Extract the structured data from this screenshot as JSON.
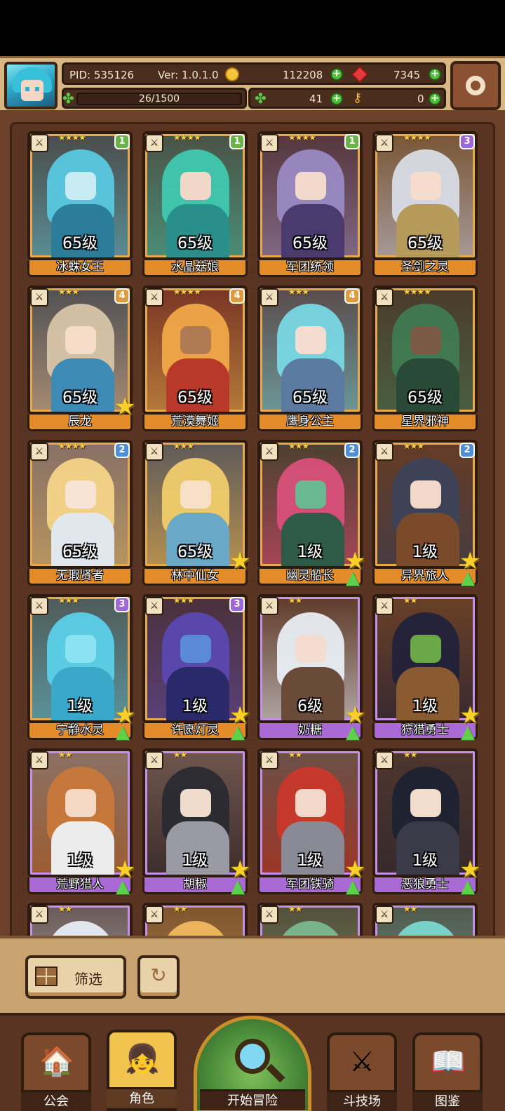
{
  "header": {
    "pid": "PID: 535126",
    "version": "Ver: 1.0.1.0",
    "gold": "112208",
    "gems": "7345",
    "exp": "26/1500",
    "clover": "41",
    "keys": "0"
  },
  "cards": [
    {
      "name": "冰蛛女王",
      "level": "65级",
      "stars": "★★★★",
      "badge": "1",
      "badge_color": "green",
      "tier": "gold",
      "colors": [
        "#58c8e0",
        "#c9ecf4",
        "#2c7d9a"
      ],
      "arrow": false,
      "star": false
    },
    {
      "name": "水晶菇娘",
      "level": "65级",
      "stars": "★★★★",
      "badge": "1",
      "badge_color": "green",
      "tier": "gold",
      "colors": [
        "#40c8b0",
        "#f1d7c8",
        "#2a8f8a"
      ],
      "arrow": false,
      "star": false
    },
    {
      "name": "军团统领",
      "level": "65级",
      "stars": "★★★★",
      "badge": "1",
      "badge_color": "green",
      "tier": "gold",
      "colors": [
        "#9a8ac4",
        "#f3d8cc",
        "#4a3a6e"
      ],
      "arrow": false,
      "star": false
    },
    {
      "name": "圣剑之灵",
      "level": "65级",
      "stars": "★★★★",
      "badge": "3",
      "badge_color": "purple",
      "tier": "gold",
      "colors": [
        "#d8dce6",
        "#f5dccc",
        "#b69a5a"
      ],
      "arrow": false,
      "star": false
    },
    {
      "name": "辰龙",
      "level": "65级",
      "stars": "★★★",
      "badge": "4",
      "badge_color": "orange",
      "tier": "gold",
      "colors": [
        "#d7c4a8",
        "#f4dcc8",
        "#3d8ab4"
      ],
      "arrow": false,
      "star": true
    },
    {
      "name": "荒漠舞姬",
      "level": "65级",
      "stars": "★★★★",
      "badge": "4",
      "badge_color": "orange",
      "tier": "gold",
      "colors": [
        "#f0a848",
        "#b07a52",
        "#b8382a"
      ],
      "arrow": false,
      "star": false
    },
    {
      "name": "鹰身公主",
      "level": "65级",
      "stars": "★★★",
      "badge": "4",
      "badge_color": "orange",
      "tier": "gold",
      "colors": [
        "#78d8e4",
        "#f4dcd0",
        "#5a7aa0"
      ],
      "arrow": false,
      "star": false
    },
    {
      "name": "星界邪神",
      "level": "65级",
      "stars": "★★★★",
      "badge": "",
      "badge_color": "blue",
      "tier": "gold",
      "colors": [
        "#3f7a52",
        "#7a5a44",
        "#2a4a38"
      ],
      "arrow": false,
      "star": false
    },
    {
      "name": "无瑕贤者",
      "level": "65级",
      "stars": "★★★★",
      "badge": "2",
      "badge_color": "blue",
      "tier": "gold",
      "colors": [
        "#f4d488",
        "#f8e4d4",
        "#e0e8ee"
      ],
      "arrow": false,
      "star": false
    },
    {
      "name": "林中仙女",
      "level": "65级",
      "stars": "★★★",
      "badge": "",
      "badge_color": "blue",
      "tier": "gold",
      "colors": [
        "#f0cc6c",
        "#f8e0c8",
        "#6aa8c8"
      ],
      "arrow": false,
      "star": true
    },
    {
      "name": "幽灵船长",
      "level": "1级",
      "stars": "★★★",
      "badge": "2",
      "badge_color": "blue",
      "tier": "gold",
      "colors": [
        "#d8507a",
        "#6ab890",
        "#2e5a48"
      ],
      "arrow": true,
      "star": true
    },
    {
      "name": "异界旅人",
      "level": "1级",
      "stars": "★★★",
      "badge": "2",
      "badge_color": "blue",
      "tier": "gold",
      "colors": [
        "#3c4258",
        "#f2d8c8",
        "#7a4a2a"
      ],
      "arrow": true,
      "star": true
    },
    {
      "name": "宁静水灵",
      "level": "1级",
      "stars": "★★★",
      "badge": "3",
      "badge_color": "purple",
      "tier": "gold",
      "colors": [
        "#5ad0e8",
        "#8ae2f0",
        "#3aa8c8"
      ],
      "arrow": true,
      "star": true
    },
    {
      "name": "许愿灯灵",
      "level": "1级",
      "stars": "★★★",
      "badge": "3",
      "badge_color": "purple",
      "tier": "gold",
      "colors": [
        "#5a48b0",
        "#5a8ad8",
        "#2a2a6a"
      ],
      "arrow": true,
      "star": true
    },
    {
      "name": "奶糖",
      "level": "6级",
      "stars": "★★",
      "badge": "",
      "badge_color": "blue",
      "tier": "purple",
      "colors": [
        "#e8eef4",
        "#f4dcd0",
        "#6a4a38"
      ],
      "arrow": true,
      "star": true
    },
    {
      "name": "狩猎勇士",
      "level": "1级",
      "stars": "★★",
      "badge": "",
      "badge_color": "blue",
      "tier": "purple",
      "colors": [
        "#22223a",
        "#6aa848",
        "#8a5a30"
      ],
      "arrow": true,
      "star": true
    },
    {
      "name": "荒野猎人",
      "level": "1级",
      "stars": "★★",
      "badge": "",
      "badge_color": "blue",
      "tier": "purple",
      "colors": [
        "#c8783a",
        "#f4d8c4",
        "#ececec"
      ],
      "arrow": true,
      "star": true
    },
    {
      "name": "胡椒",
      "level": "1级",
      "stars": "★★",
      "badge": "",
      "badge_color": "blue",
      "tier": "purple",
      "colors": [
        "#2a2a32",
        "#f0dccc",
        "#9a9aa4"
      ],
      "arrow": true,
      "star": true
    },
    {
      "name": "军团铁骑",
      "level": "1级",
      "stars": "★★",
      "badge": "",
      "badge_color": "blue",
      "tier": "purple",
      "colors": [
        "#c8382a",
        "#f2d8c8",
        "#8a8a96"
      ],
      "arrow": true,
      "star": true
    },
    {
      "name": "恶狼勇士",
      "level": "1级",
      "stars": "★★",
      "badge": "",
      "badge_color": "blue",
      "tier": "purple",
      "colors": [
        "#1e2232",
        "#f2dccc",
        "#3a3a48"
      ],
      "arrow": true,
      "star": true
    },
    {
      "name": "",
      "level": "",
      "stars": "★★",
      "badge": "",
      "badge_color": "blue",
      "tier": "purple",
      "colors": [
        "#e8eef4",
        "#f4dcd0",
        "#8aa8c8"
      ],
      "arrow": false,
      "star": false
    },
    {
      "name": "",
      "level": "",
      "stars": "★★",
      "badge": "",
      "badge_color": "blue",
      "tier": "purple",
      "colors": [
        "#f0b860",
        "#f4dcd0",
        "#c89848"
      ],
      "arrow": false,
      "star": false
    },
    {
      "name": "",
      "level": "",
      "stars": "★★",
      "badge": "",
      "badge_color": "blue",
      "tier": "purple",
      "colors": [
        "#7ab890",
        "#f4dcd0",
        "#4a8a68"
      ],
      "arrow": false,
      "star": false
    },
    {
      "name": "",
      "level": "",
      "stars": "★★",
      "badge": "",
      "badge_color": "blue",
      "tier": "purple",
      "colors": [
        "#7ad8d0",
        "#f4dcd0",
        "#3aa8a0"
      ],
      "arrow": false,
      "star": false
    }
  ],
  "toolbar": {
    "filter_label": "筛选",
    "refresh_icon": "refresh-icon"
  },
  "nav": {
    "guild": "公会",
    "characters": "角色",
    "adventure": "开始冒险",
    "arena": "斗技场",
    "codex": "图鉴"
  }
}
